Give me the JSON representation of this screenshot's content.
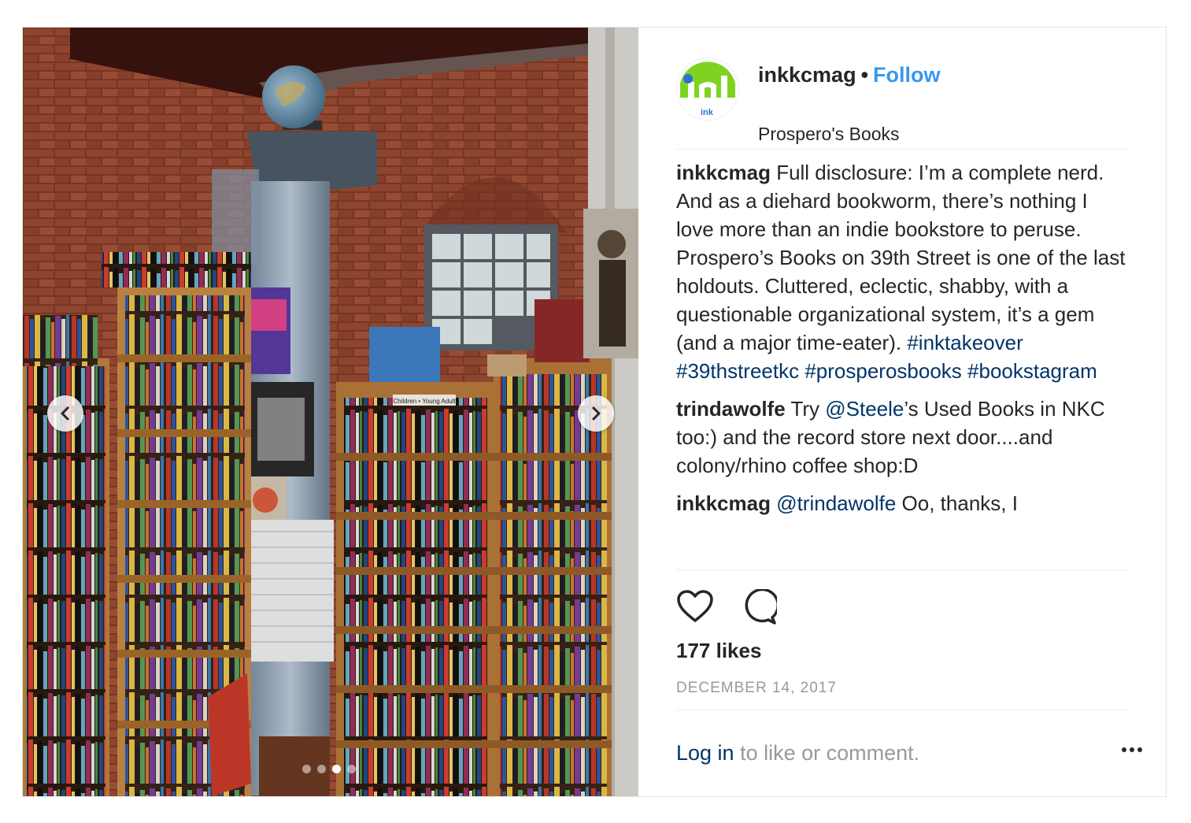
{
  "post": {
    "author": {
      "username": "inkkcmag",
      "separator": "•",
      "follow_label": "Follow",
      "location": "Prospero's Books",
      "avatar_text": "ink"
    },
    "media": {
      "carousel_index": 3,
      "carousel_count": 4,
      "shelf_sign": "Children • Young Adult"
    },
    "comments": [
      {
        "username": "inkkcmag",
        "text": "Full disclosure: I’m a complete nerd. And as a diehard bookworm, there’s nothing I love more than an indie bookstore to peruse. Prospero’s Books on 39th Street is one of the last holdouts. Cluttered, eclectic, shabby, with a questionable organizational system, it’s a gem (and a major time-eater).",
        "hashtags": [
          "#inktakeover",
          "#39thstreetkc",
          "#prosperosbooks",
          "#bookstagram"
        ]
      },
      {
        "username": "trindawolfe",
        "before_mention": "Try ",
        "mention": "@Steele",
        "after_mention": "’s Used Books in NKC too:) and the record store next door....and colony/rhino coffee shop:D"
      },
      {
        "username": "inkkcmag",
        "mention": "@trindawolfe",
        "after_mention": " Oo, thanks, I"
      }
    ],
    "likes": "177 likes",
    "date": "DECEMBER 14, 2017",
    "login_link": "Log in",
    "login_rest": " to like or comment.",
    "colors": {
      "follow": "#3897f0",
      "link": "#003569",
      "muted": "#999999",
      "avatar_green": "#7ed321",
      "avatar_blue": "#2d6fd6"
    },
    "icons": [
      "heart-icon",
      "comment-icon",
      "more-icon",
      "chevron-left-icon",
      "chevron-right-icon"
    ]
  }
}
